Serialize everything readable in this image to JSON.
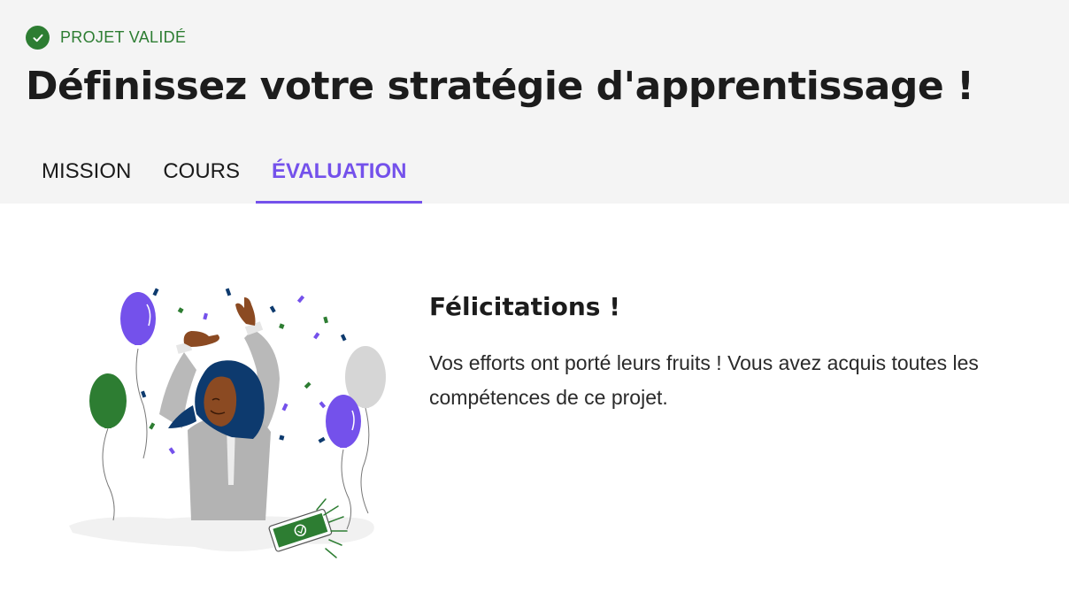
{
  "header": {
    "status_label": "PROJET VALIDÉ",
    "title": "Définissez votre stratégie d'apprentissage !"
  },
  "tabs": [
    {
      "label": "MISSION",
      "active": false
    },
    {
      "label": "COURS",
      "active": false
    },
    {
      "label": "ÉVALUATION",
      "active": true
    }
  ],
  "result": {
    "title": "Félicitations !",
    "message": "Vos efforts ont porté leurs fruits ! Vous avez acquis toutes les compétences de ce projet."
  },
  "colors": {
    "accent": "#7451eb",
    "success": "#2d7d32",
    "header_bg": "#f4f4f4"
  },
  "icons": {
    "status": "check-circle-icon",
    "illustration": "celebration-illustration"
  }
}
